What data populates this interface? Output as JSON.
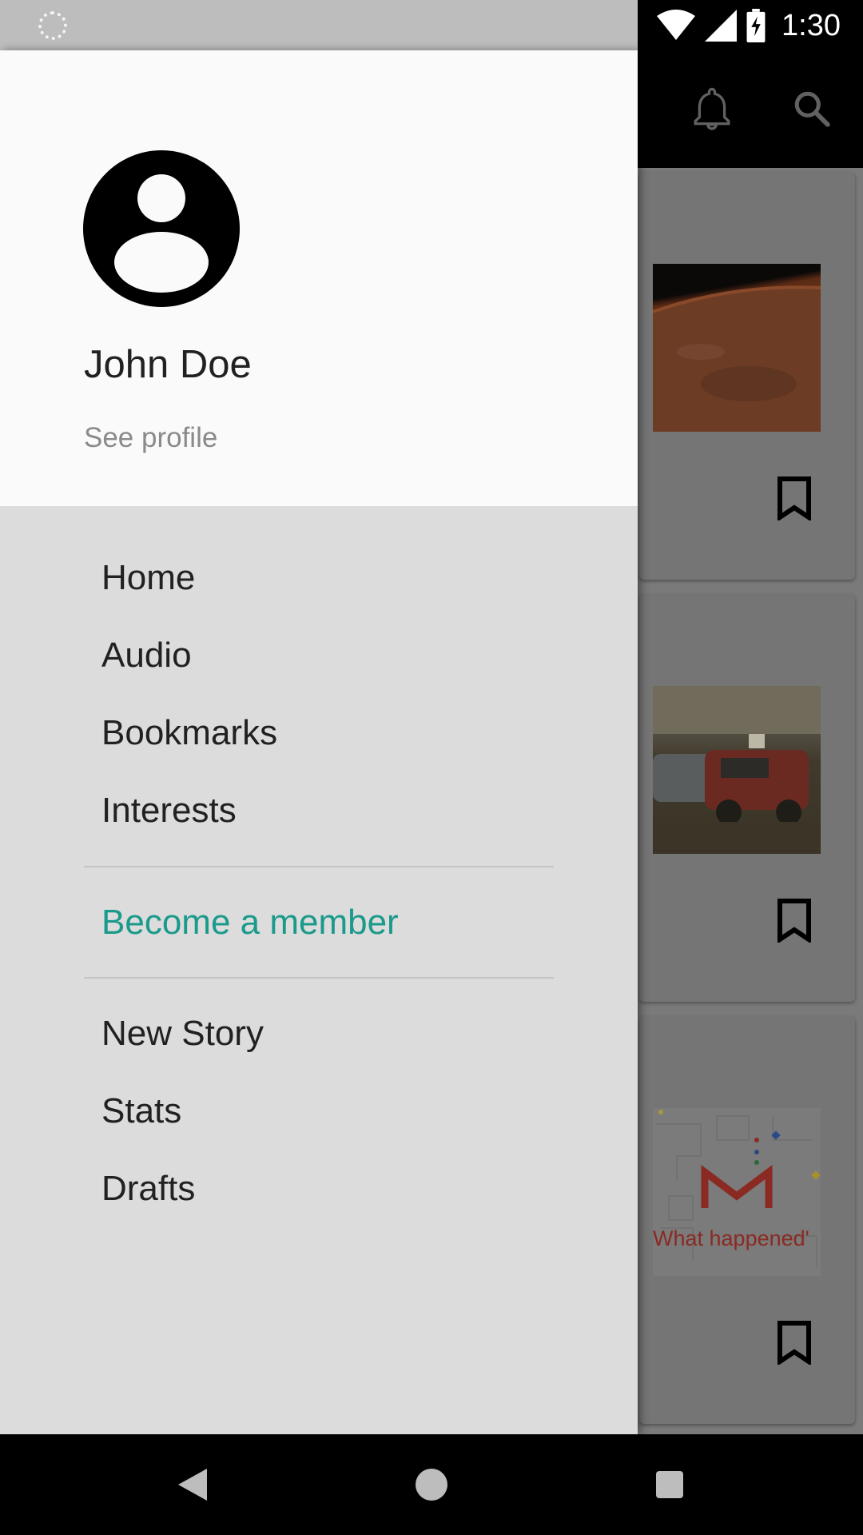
{
  "status_bar": {
    "time": "1:30",
    "icons": [
      "sync-icon",
      "wifi-icon",
      "signal-icon",
      "battery-charging-icon"
    ]
  },
  "app_toolbar": {
    "icons": [
      "bell-icon",
      "search-icon"
    ]
  },
  "background_cards": [
    {
      "thumbnail": "mars-photo",
      "action_icon": "bookmark-icon"
    },
    {
      "thumbnail": "demolition-derby-photo",
      "action_icon": "bookmark-icon"
    },
    {
      "thumbnail": "gmail-graphic",
      "thumbnail_text": "What happened'",
      "action_icon": "bookmark-icon"
    }
  ],
  "drawer": {
    "profile": {
      "avatar_icon": "account-circle-icon",
      "name": "John Doe",
      "link": "See profile"
    },
    "primary_items": [
      {
        "label": "Home"
      },
      {
        "label": "Audio"
      },
      {
        "label": "Bookmarks"
      },
      {
        "label": "Interests"
      }
    ],
    "membership_item": {
      "label": "Become a member"
    },
    "secondary_items": [
      {
        "label": "New Story"
      },
      {
        "label": "Stats"
      },
      {
        "label": "Drafts"
      }
    ]
  },
  "colors": {
    "accent": "#1a9a8b",
    "drawer_header": "#fafafa",
    "drawer_body": "#dcdcdc",
    "status_bar_left": "#bdbdbd"
  },
  "nav_bar": {
    "icons": [
      "back-icon",
      "home-icon",
      "recents-icon"
    ]
  }
}
